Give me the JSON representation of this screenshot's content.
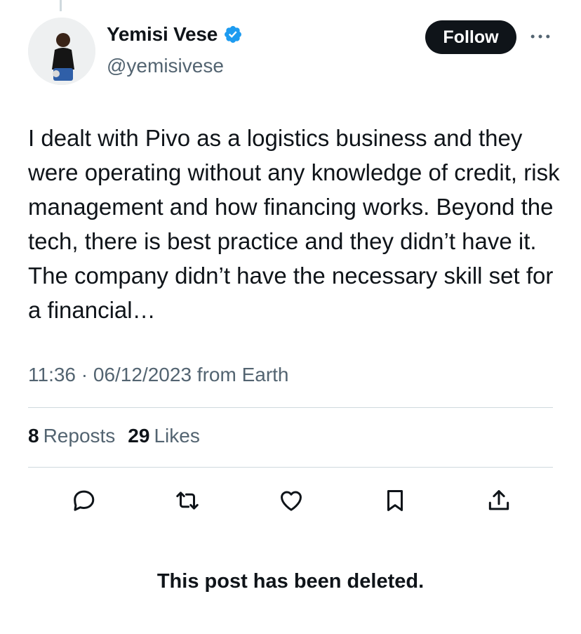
{
  "author": {
    "display_name": "Yemisi Vese",
    "handle": "@yemisivese",
    "verified_icon": "verified-badge-icon",
    "avatar": "profile-photo"
  },
  "follow_label": "Follow",
  "more_icon": "more-options-icon",
  "tweet": {
    "text": "I dealt with Pivo as a logistics business and they were operating without any knowledge of credit, risk management and how financing works. Beyond the tech, there is best practice and they didn’t have it. The company didn’t have the necessary skill set for a financial…",
    "meta": "11:36 · 06/12/2023 from Earth"
  },
  "stats": {
    "reposts_count": "8",
    "reposts_label": "Reposts",
    "likes_count": "29",
    "likes_label": "Likes"
  },
  "actions": [
    "reply-icon",
    "repost-icon",
    "like-icon",
    "bookmark-icon",
    "share-icon"
  ],
  "notice": "This post has been deleted.",
  "colors": {
    "text": "#0f1419",
    "secondary": "#536471",
    "divider": "#cfd9de",
    "verified": "#1d9bf0",
    "follow_bg": "#0f1419"
  }
}
